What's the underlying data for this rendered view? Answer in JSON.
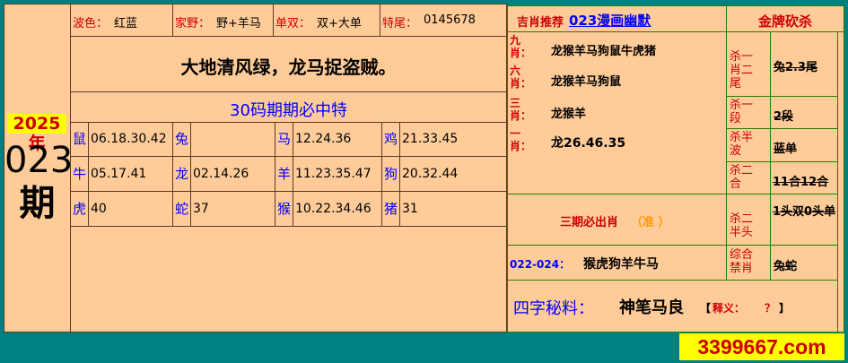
{
  "left": {
    "year": "2025年",
    "issue": "023",
    "period_char": "期"
  },
  "info_row": [
    {
      "label": "波色：",
      "value": "红蓝"
    },
    {
      "label": "家野：",
      "value": "野+羊马"
    },
    {
      "label": "单双：",
      "value": "双+大单"
    },
    {
      "label": "特尾：",
      "value": "0145678"
    }
  ],
  "slogan": "大地清风绿，龙马捉盗贼。",
  "guarantee": "30码期期必中特",
  "zodiac_rows": [
    [
      {
        "z": "鼠",
        "n": "06.18.30.42"
      },
      {
        "z": "兔",
        "n": ""
      },
      {
        "z": "马",
        "n": "12.24.36"
      },
      {
        "z": "鸡",
        "n": "21.33.45"
      }
    ],
    [
      {
        "z": "牛",
        "n": "05.17.41"
      },
      {
        "z": "龙",
        "n": "02.14.26"
      },
      {
        "z": "羊",
        "n": "11.23.35.47"
      },
      {
        "z": "狗",
        "n": "20.32.44"
      }
    ],
    [
      {
        "z": "虎",
        "n": "40"
      },
      {
        "z": "蛇",
        "n": "37"
      },
      {
        "z": "猴",
        "n": "10.22.34.46"
      },
      {
        "z": "猪",
        "n": "31"
      }
    ]
  ],
  "right_header": {
    "title_prefix": "吉肖推荐",
    "title_link": "023漫画幽默",
    "gold": "金牌砍杀"
  },
  "side_labels": [
    "九肖：",
    "六肖：",
    "三肖：",
    "一肖："
  ],
  "picks": [
    {
      "text": "龙猴羊马狗鼠牛虎猪"
    },
    {
      "text": "龙猴羊马狗鼠"
    },
    {
      "text": "龙猴羊"
    },
    {
      "text": "龙26.46.35"
    }
  ],
  "kill": [
    {
      "label": "杀一肖二尾",
      "value": "兔2.3尾"
    },
    {
      "label": "杀一段",
      "value": "2段"
    },
    {
      "label": "杀半波",
      "value": "蓝单"
    },
    {
      "label": "杀二合",
      "value": "11合12合"
    },
    {
      "label": "杀二半头",
      "value": "1头双0头单"
    },
    {
      "label": "综合禁肖",
      "value": "兔蛇"
    }
  ],
  "three_period": {
    "text": "三期必出肖",
    "tag": "（准 ）"
  },
  "range_pick": {
    "label": "022-024：",
    "value": "猴虎狗羊牛马"
  },
  "secret": {
    "label": "四字秘料：",
    "value": "神笔马良",
    "note_open": "【",
    "note_label": "释义：",
    "note_q": "？",
    "note_close": "】"
  },
  "watermark": "3399667.com",
  "colors": {
    "bg": "#008080",
    "cell": "#ffcc99",
    "red": "#cc0000",
    "blue": "#0000ff",
    "gold_bg": "#ffff00"
  }
}
